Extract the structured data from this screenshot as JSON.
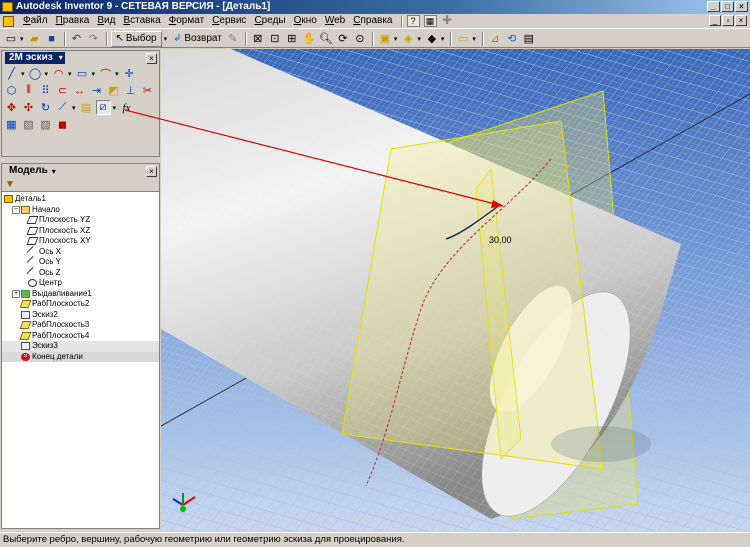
{
  "window": {
    "title": "Autodesk Inventor 9  -  СЕТЕВАЯ ВЕРСИЯ - [Деталь1]"
  },
  "menu": {
    "items": [
      "Файл",
      "Правка",
      "Вид",
      "Вставка",
      "Формат",
      "Сервис",
      "Среды",
      "Окно",
      "Web",
      "Справка"
    ]
  },
  "toolbar": {
    "select_label": "Выбор",
    "return_label": "Возврат"
  },
  "sketch_panel": {
    "title": "2М эскиз"
  },
  "model_panel": {
    "title": "Модель",
    "tree": [
      {
        "label": "Деталь1",
        "icon": "part-icon",
        "level": 0
      },
      {
        "label": "Начало",
        "icon": "folder-icon",
        "level": 1,
        "expander": "−"
      },
      {
        "label": "Плоскость YZ",
        "icon": "plane-icon",
        "level": 2
      },
      {
        "label": "Плоскость XZ",
        "icon": "plane-icon",
        "level": 2
      },
      {
        "label": "Плоскость XY",
        "icon": "plane-icon",
        "level": 2
      },
      {
        "label": "Ось X",
        "icon": "axis-icon",
        "level": 2
      },
      {
        "label": "Ось Y",
        "icon": "axis-icon",
        "level": 2
      },
      {
        "label": "Ось Z",
        "icon": "axis-icon",
        "level": 2
      },
      {
        "label": "Центр",
        "icon": "point-icon",
        "level": 2
      },
      {
        "label": "Выдавливание1",
        "icon": "extrude-icon",
        "level": 1,
        "expander": "+"
      },
      {
        "label": "РабПлоскость2",
        "icon": "workplane-icon",
        "level": 1
      },
      {
        "label": "Эскиз2",
        "icon": "sketch-icon",
        "level": 1
      },
      {
        "label": "РабПлоскость3",
        "icon": "workplane-icon",
        "level": 1
      },
      {
        "label": "РабПлоскость4",
        "icon": "workplane-icon",
        "level": 1
      },
      {
        "label": "Эскиз3",
        "icon": "sketch-icon",
        "level": 1
      },
      {
        "label": "Конец детали",
        "icon": "end-of-part-icon",
        "level": 1
      }
    ]
  },
  "viewport": {
    "dimension": "30,00"
  },
  "status": {
    "text": "Выберите ребро, вершину, рабочую геометрию или геометрию эскиза для проецирования."
  }
}
